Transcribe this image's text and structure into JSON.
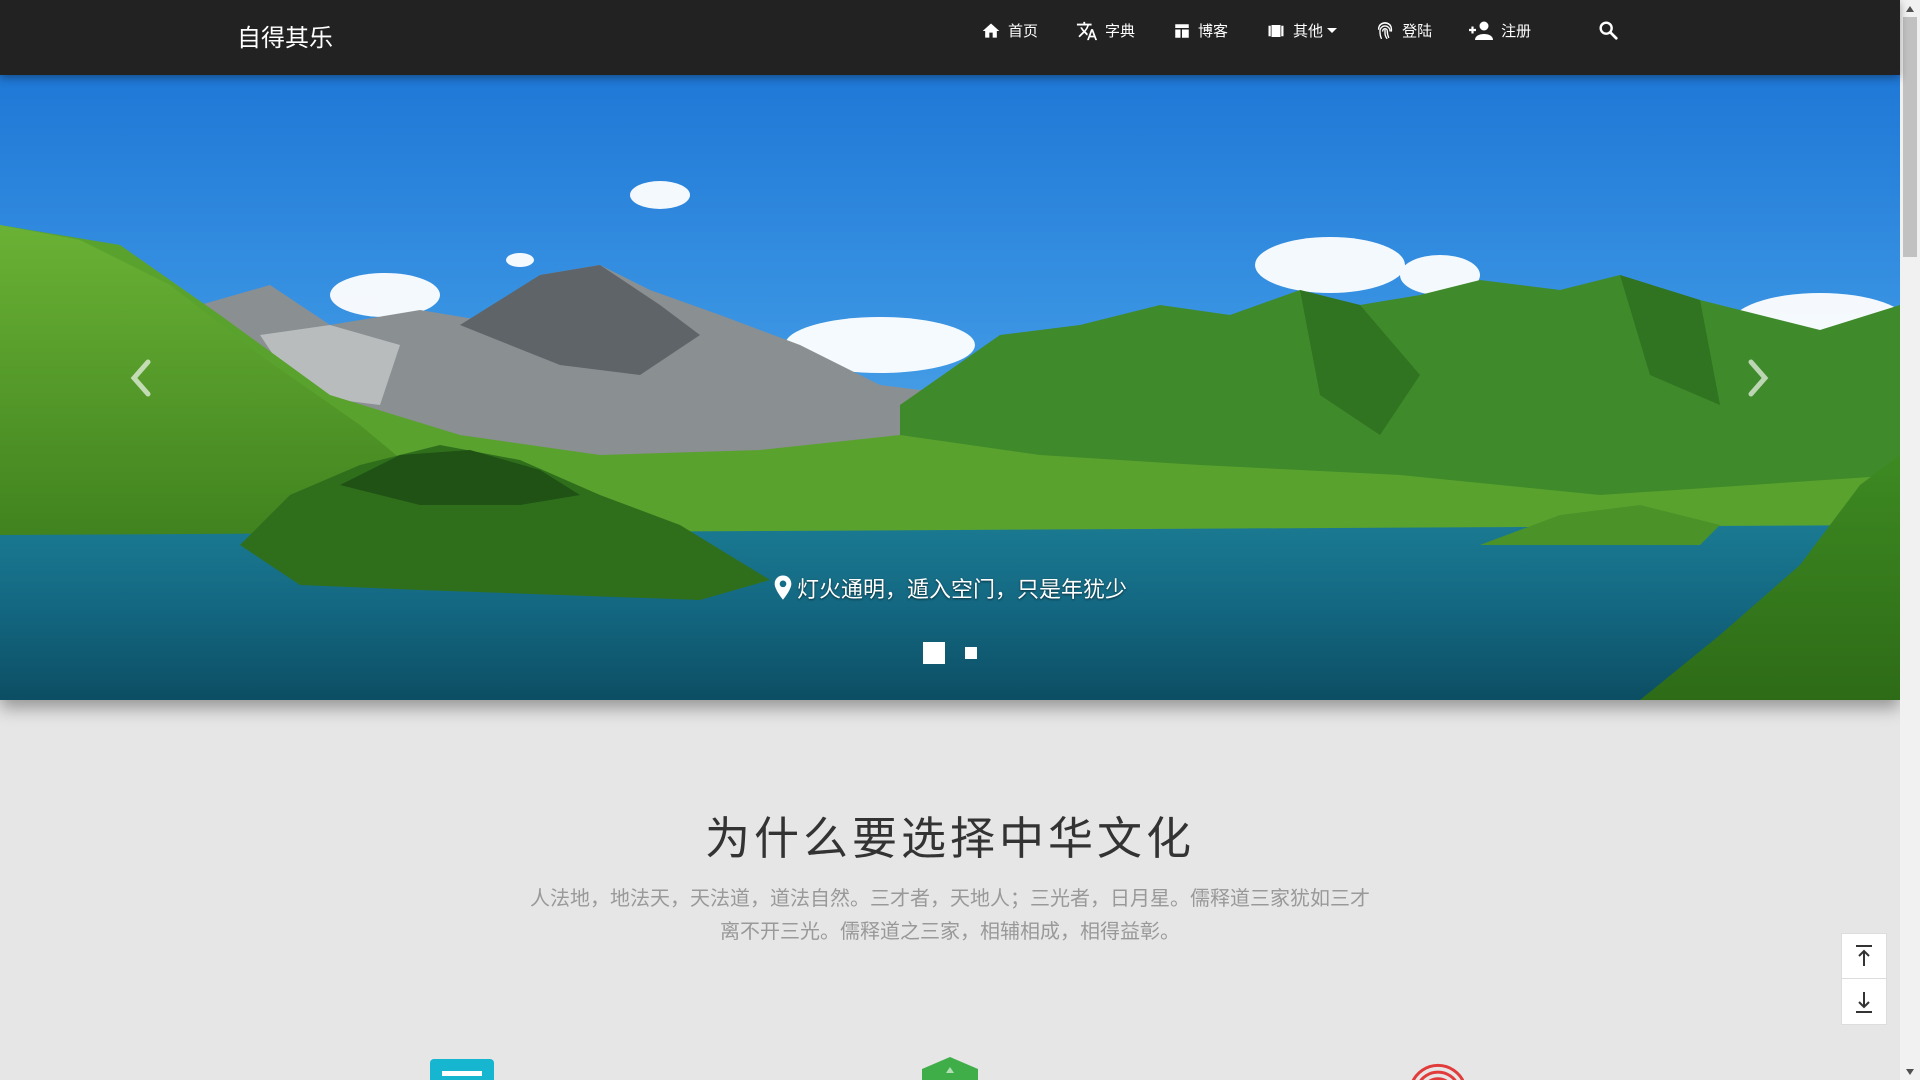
{
  "navbar": {
    "brand": "自得其乐",
    "items": [
      {
        "label": "首页",
        "icon": "home-icon"
      },
      {
        "label": "字典",
        "icon": "translate-icon"
      },
      {
        "label": "博客",
        "icon": "dashboard-icon"
      },
      {
        "label": "其他",
        "icon": "video-icon"
      },
      {
        "label": "登陆",
        "icon": "fingerprint-icon"
      },
      {
        "label": "注册",
        "icon": "person-add-icon"
      }
    ],
    "search_icon": "search-icon"
  },
  "carousel": {
    "caption": "灯火通明，遁入空门，只是年犹少",
    "caption_icon": "location-pin-icon",
    "slide_count": 2,
    "active_slide": 1
  },
  "section": {
    "title": "为什么要选择中华文化",
    "desc_line1": "人法地，地法天，天法道，道法自然。三才者，天地人；三光者，日月星。儒释道三家犹如三才",
    "desc_line2": "离不开三光。儒释道之三家，相辅相成，相得益彰。"
  },
  "features": [
    {
      "icon": "document-icon",
      "color": "#16b5d0"
    },
    {
      "icon": "hexagon-icon",
      "color": "#3fae49"
    },
    {
      "icon": "wifi-signal-icon",
      "color": "#e23b3b"
    }
  ],
  "scroll_buttons": {
    "top_icon": "arrow-to-top-icon",
    "bottom_icon": "arrow-to-bottom-icon"
  },
  "colors": {
    "navbar_bg": "#222222",
    "page_bg": "#e6e6e6",
    "title_text": "#333333",
    "desc_text": "#999999"
  }
}
